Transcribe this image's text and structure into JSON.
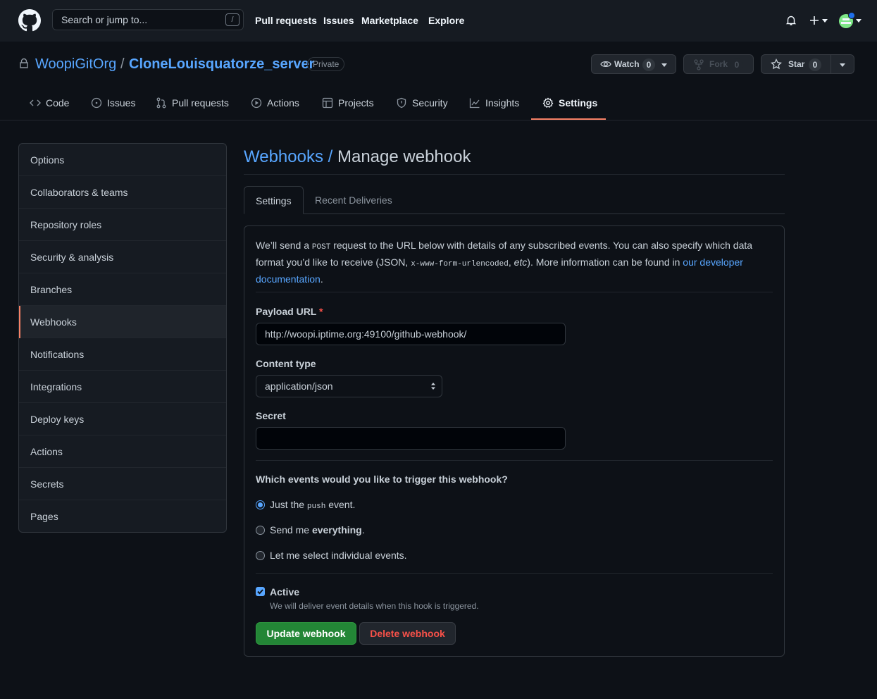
{
  "header": {
    "search_placeholder": "Search or jump to...",
    "search_shortcut": "/",
    "nav": [
      "Pull requests",
      "Issues",
      "Marketplace",
      "Explore"
    ]
  },
  "repo": {
    "owner": "WoopiGitOrg",
    "separator": "/",
    "name": "CloneLouisquatorze_server",
    "visibility": "Private",
    "watch": {
      "label": "Watch",
      "count": "0"
    },
    "fork": {
      "label": "Fork",
      "count": "0"
    },
    "star": {
      "label": "Star",
      "count": "0"
    }
  },
  "tabs": [
    {
      "label": "Code",
      "icon": "code-icon"
    },
    {
      "label": "Issues",
      "icon": "issue-opened-icon"
    },
    {
      "label": "Pull requests",
      "icon": "git-pull-request-icon"
    },
    {
      "label": "Actions",
      "icon": "play-icon"
    },
    {
      "label": "Projects",
      "icon": "table-icon"
    },
    {
      "label": "Security",
      "icon": "shield-icon"
    },
    {
      "label": "Insights",
      "icon": "graph-icon"
    },
    {
      "label": "Settings",
      "icon": "gear-icon",
      "selected": true
    }
  ],
  "sidebar": {
    "items": [
      "Options",
      "Collaborators & teams",
      "Repository roles",
      "Security & analysis",
      "Branches",
      "Webhooks",
      "Notifications",
      "Integrations",
      "Deploy keys",
      "Actions",
      "Secrets",
      "Pages"
    ],
    "selected": "Webhooks"
  },
  "page": {
    "breadcrumb": "Webhooks",
    "breadcrumb_sep": " / ",
    "title": "Manage webhook",
    "subtabs": [
      "Settings",
      "Recent Deliveries"
    ]
  },
  "intro": {
    "t1": "We’ll send a ",
    "code1": "POST",
    "t2": " request to the URL below with details of any subscribed events. You can also specify which data format you’d like to receive (JSON, ",
    "code2": "x-www-form-urlencoded",
    "t3": ", ",
    "etc": "etc",
    "t4": "). More information can be found in ",
    "link": "our developer documentation",
    "t5": "."
  },
  "form": {
    "payload_label": "Payload URL",
    "required_mark": "*",
    "payload_value": "http://woopi.iptime.org:49100/github-webhook/",
    "content_type_label": "Content type",
    "content_type_value": "application/json",
    "secret_label": "Secret",
    "secret_value": "",
    "events_question": "Which events would you like to trigger this webhook?",
    "event_push_pre": "Just the ",
    "event_push_code": "push",
    "event_push_post": " event.",
    "event_all_pre": "Send me ",
    "event_all_strong": "everything",
    "event_all_post": ".",
    "event_select": "Let me select individual events.",
    "active_label": "Active",
    "active_note": "We will deliver event details when this hook is triggered.",
    "update_button": "Update webhook",
    "delete_button": "Delete webhook"
  },
  "colors": {
    "accent": "#58a6ff",
    "selected_tab": "#f78166",
    "primary_button": "#238636",
    "danger": "#f85149"
  }
}
